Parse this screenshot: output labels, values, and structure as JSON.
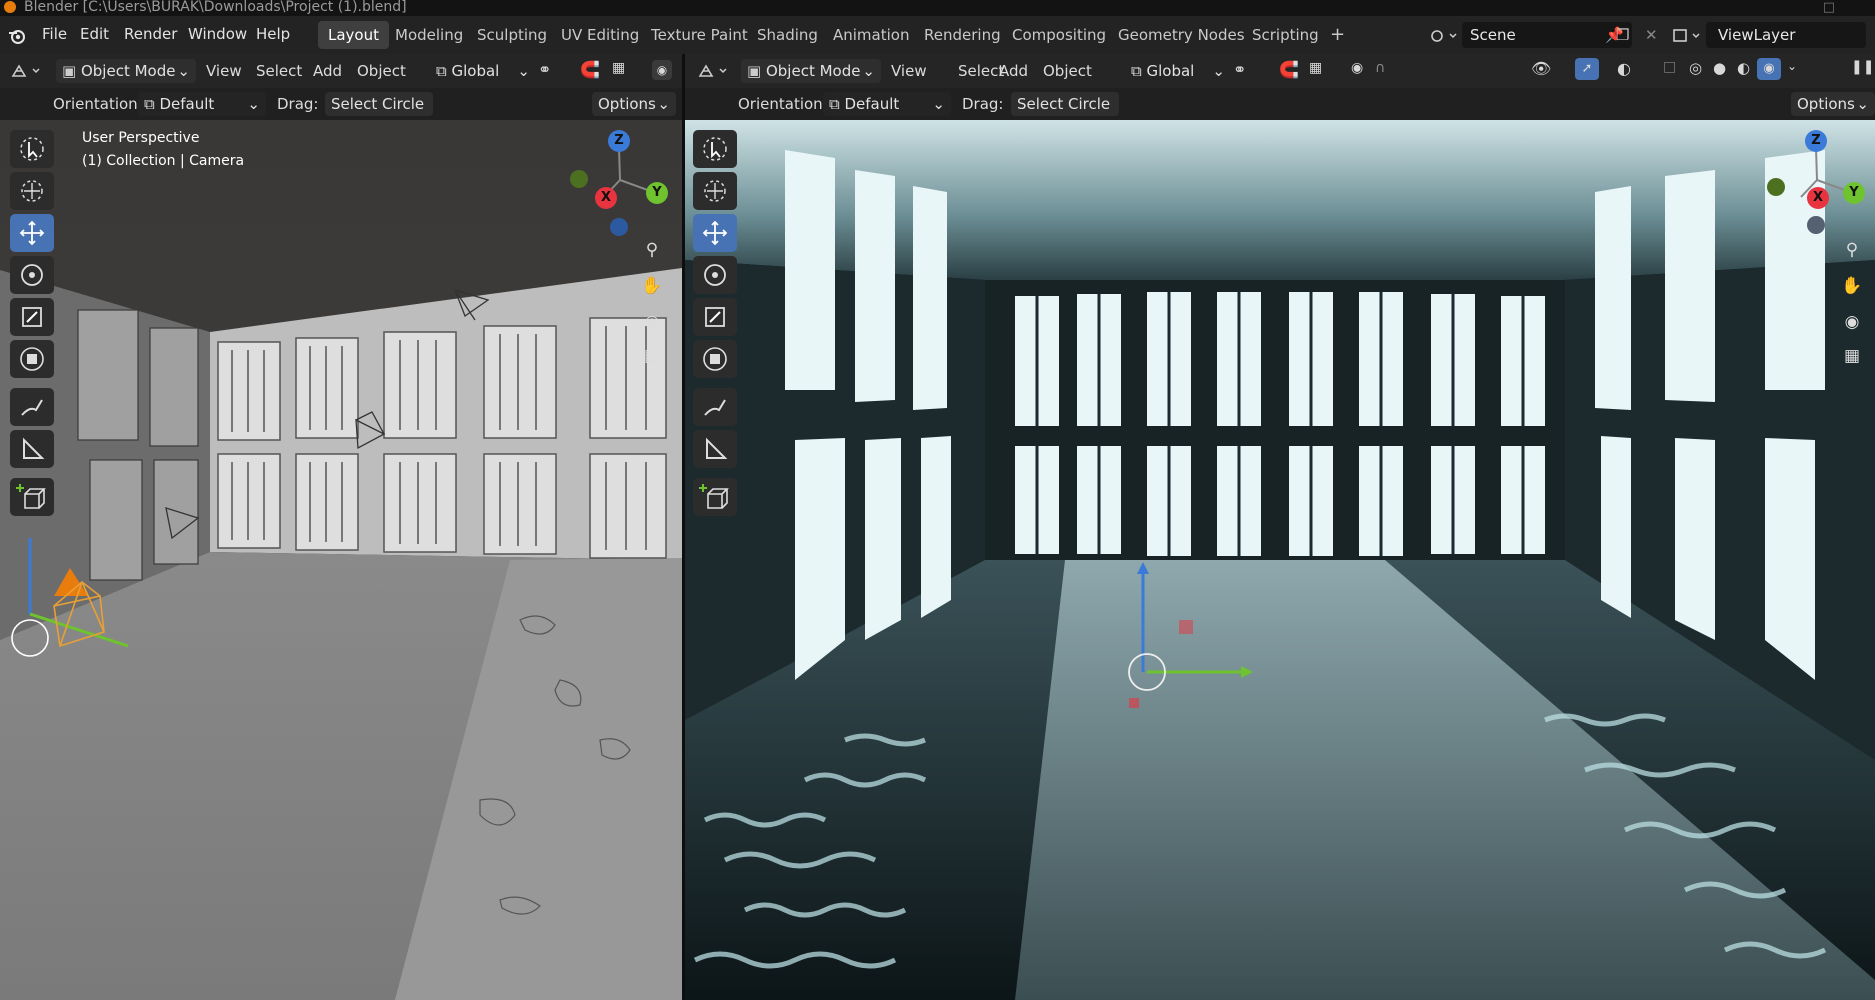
{
  "window": {
    "title": "Blender [C:\\Users\\BURAK\\Downloads\\Project (1).blend]"
  },
  "menus": [
    "File",
    "Edit",
    "Render",
    "Window",
    "Help"
  ],
  "workspaces": [
    "Layout",
    "Modeling",
    "Sculpting",
    "UV Editing",
    "Texture Paint",
    "Shading",
    "Animation",
    "Rendering",
    "Compositing",
    "Geometry Nodes",
    "Scripting"
  ],
  "active_workspace": "Layout",
  "add_workspace": "+",
  "scene": {
    "name": "Scene"
  },
  "view_layer": {
    "name": "ViewLayer"
  },
  "left_viewport": {
    "mode": "Object Mode",
    "header_menus": [
      "View",
      "Select",
      "Add",
      "Object"
    ],
    "transform_orientation": "Global",
    "orientation_label": "Orientation:",
    "orientation_value": "Default",
    "drag_label": "Drag:",
    "drag_value": "Select Circle",
    "options": "Options",
    "overlay_line1": "User Perspective",
    "overlay_line2": "(1) Collection | Camera",
    "shading": "solid"
  },
  "right_viewport": {
    "mode": "Object Mode",
    "header_menus": [
      "View",
      "Select",
      "Add",
      "Object"
    ],
    "transform_orientation": "Global",
    "orientation_label": "Orientation:",
    "orientation_value": "Default",
    "drag_label": "Drag:",
    "drag_value": "Select Circle",
    "options": "Options",
    "shading": "rendered"
  },
  "gizmo_axes": {
    "z": "Z",
    "x": "X",
    "y": "Y"
  },
  "colors": {
    "accent": "#4772b3",
    "x_axis": "#e8343f",
    "y_axis": "#6ec32e",
    "z_axis": "#3a7ad8",
    "orange": "#e87d0d"
  }
}
